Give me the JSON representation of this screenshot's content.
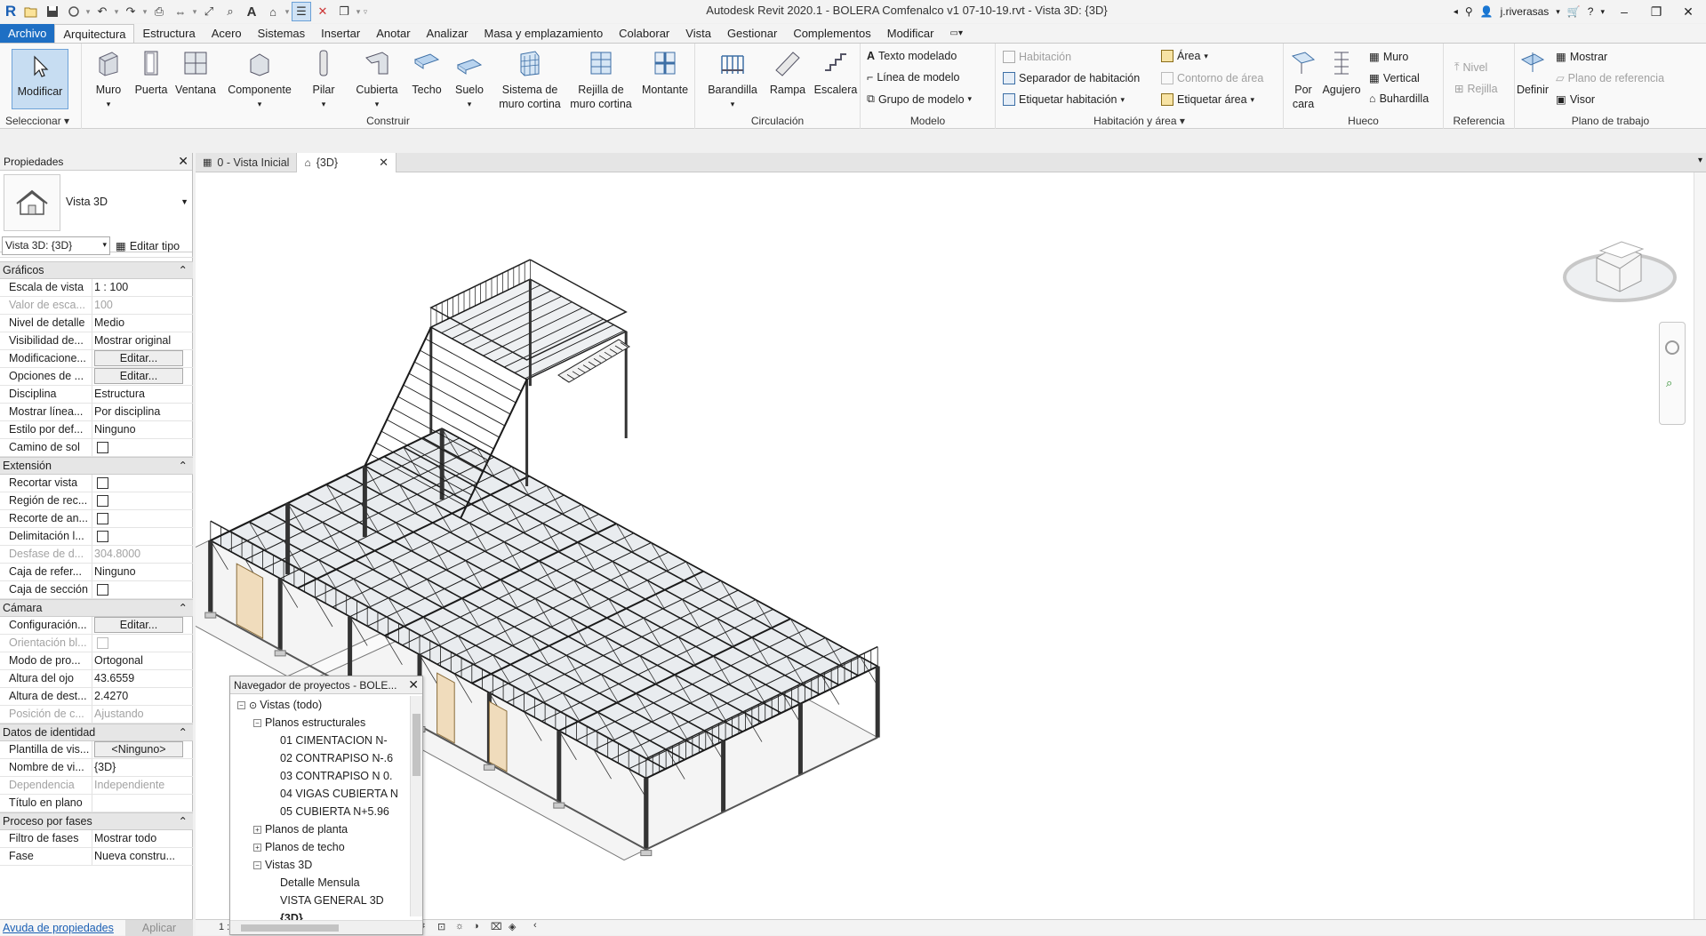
{
  "window": {
    "title": "Autodesk Revit 2020.1 - BOLERA Comfenalco v1 07-10-19.rvt - Vista 3D: {3D}",
    "user": "j.riverasas"
  },
  "menu_tabs": [
    "Archivo",
    "Arquitectura",
    "Estructura",
    "Acero",
    "Sistemas",
    "Insertar",
    "Anotar",
    "Analizar",
    "Masa y emplazamiento",
    "Colaborar",
    "Vista",
    "Gestionar",
    "Complementos",
    "Modificar"
  ],
  "ribbon": {
    "select": {
      "modify": "Modificar",
      "title": "Seleccionar"
    },
    "build": {
      "title": "Construir",
      "wall": "Muro",
      "door": "Puerta",
      "window": "Ventana",
      "component": "Componente",
      "column": "Pilar",
      "roof": "Cubierta",
      "ceiling": "Techo",
      "floor": "Suelo",
      "curtain_system_1": "Sistema de",
      "curtain_system_2": "muro cortina",
      "curtain_grid_1": "Rejilla de",
      "curtain_grid_2": "muro cortina",
      "mullion": "Montante"
    },
    "circulation": {
      "title": "Circulación",
      "railing": "Barandilla",
      "ramp": "Rampa",
      "stair": "Escalera"
    },
    "model": {
      "title": "Modelo",
      "text": "Texto modelado",
      "line": "Línea de modelo",
      "group": "Grupo de modelo"
    },
    "room": {
      "title": "Habitación y área",
      "room": "Habitación",
      "separator": "Separador  de habitación",
      "tag_room": "Etiquetar  habitación",
      "area": "Área",
      "area_boundary": "Contorno  de área",
      "tag_area": "Etiquetar  área"
    },
    "opening": {
      "title": "Hueco",
      "by_face_1": "Por",
      "by_face_2": "cara",
      "shaft": "Agujero",
      "wall": "Muro",
      "vertical": "Vertical",
      "dormer": "Buhardilla"
    },
    "datum": {
      "title": "Referencia",
      "level": "Nivel",
      "grid": "Rejilla"
    },
    "workplane": {
      "title": "Plano de trabajo",
      "set": "Definir",
      "show": "Mostrar",
      "ref_plane": "Plano de referencia",
      "viewer": "Visor"
    }
  },
  "properties": {
    "title": "Propiedades",
    "type_name": "Vista 3D",
    "instance": "Vista 3D: {3D}",
    "edit_type": "Editar tipo",
    "categories": [
      {
        "name": "Gráficos",
        "rows": [
          {
            "k": "Escala de vista",
            "v": "1 : 100"
          },
          {
            "k": "Valor de esca...",
            "v": "100",
            "dim": true
          },
          {
            "k": "Nivel de detalle",
            "v": "Medio"
          },
          {
            "k": "Visibilidad de...",
            "v": "Mostrar original"
          },
          {
            "k": "Modificacione...",
            "v": "Editar...",
            "btn": true
          },
          {
            "k": "Opciones de ...",
            "v": "Editar...",
            "btn": true
          },
          {
            "k": "Disciplina",
            "v": "Estructura"
          },
          {
            "k": "Mostrar línea...",
            "v": "Por disciplina"
          },
          {
            "k": "Estilo por def...",
            "v": "Ninguno"
          },
          {
            "k": "Camino de sol",
            "v": "",
            "cb": true
          }
        ]
      },
      {
        "name": "Extensión",
        "rows": [
          {
            "k": "Recortar vista",
            "v": "",
            "cb": true
          },
          {
            "k": "Región de rec...",
            "v": "",
            "cb": true
          },
          {
            "k": "Recorte de an...",
            "v": "",
            "cb": true
          },
          {
            "k": "Delimitación l...",
            "v": "",
            "cb": true
          },
          {
            "k": "Desfase de d...",
            "v": "304.8000",
            "dim": true
          },
          {
            "k": "Caja de refer...",
            "v": "Ninguno"
          },
          {
            "k": "Caja de sección",
            "v": "",
            "cb": true
          }
        ]
      },
      {
        "name": "Cámara",
        "rows": [
          {
            "k": "Configuración...",
            "v": "Editar...",
            "btn": true
          },
          {
            "k": "Orientación bl...",
            "v": "",
            "cb": true,
            "dim": true
          },
          {
            "k": "Modo de pro...",
            "v": "Ortogonal"
          },
          {
            "k": "Altura del ojo",
            "v": "43.6559"
          },
          {
            "k": "Altura de dest...",
            "v": "2.4270"
          },
          {
            "k": "Posición de c...",
            "v": "Ajustando",
            "dim": true
          }
        ]
      },
      {
        "name": "Datos de identidad",
        "rows": [
          {
            "k": "Plantilla de vis...",
            "v": "<Ninguno>",
            "btn": true
          },
          {
            "k": "Nombre de vi...",
            "v": "{3D}"
          },
          {
            "k": "Dependencia",
            "v": "Independiente",
            "dim": true
          },
          {
            "k": "Título en plano",
            "v": ""
          }
        ]
      },
      {
        "name": "Proceso por fases",
        "rows": [
          {
            "k": "Filtro de fases",
            "v": "Mostrar todo"
          },
          {
            "k": "Fase",
            "v": "Nueva constru..."
          }
        ]
      }
    ],
    "help_link": "Avuda de propiedades",
    "apply": "Aplicar"
  },
  "view_tabs": [
    {
      "label": "0 - Vista Inicial"
    },
    {
      "label": "{3D}",
      "active": true
    }
  ],
  "browser": {
    "title": "Navegador de proyectos - BOLE...",
    "nodes": [
      {
        "label": "Vistas (todo)",
        "level": 0,
        "tog": "−",
        "icon": true
      },
      {
        "label": "Planos estructurales",
        "level": 1,
        "tog": "−"
      },
      {
        "label": "01 CIMENTACION N-",
        "level": 2
      },
      {
        "label": "02 CONTRAPISO N-.6",
        "level": 2
      },
      {
        "label": "03 CONTRAPISO N 0.",
        "level": 2
      },
      {
        "label": "04 VIGAS CUBIERTA N",
        "level": 2
      },
      {
        "label": "05 CUBIERTA N+5.96",
        "level": 2
      },
      {
        "label": "Planos de planta",
        "level": 1,
        "tog": "+"
      },
      {
        "label": "Planos de techo",
        "level": 1,
        "tog": "+"
      },
      {
        "label": "Vistas 3D",
        "level": 1,
        "tog": "−"
      },
      {
        "label": "Detalle Mensula",
        "level": 2
      },
      {
        "label": "VISTA GENERAL 3D",
        "level": 2
      },
      {
        "label": "{3D}",
        "level": 2,
        "sel": true
      }
    ]
  },
  "statusbar": {
    "scale": "1 :"
  }
}
